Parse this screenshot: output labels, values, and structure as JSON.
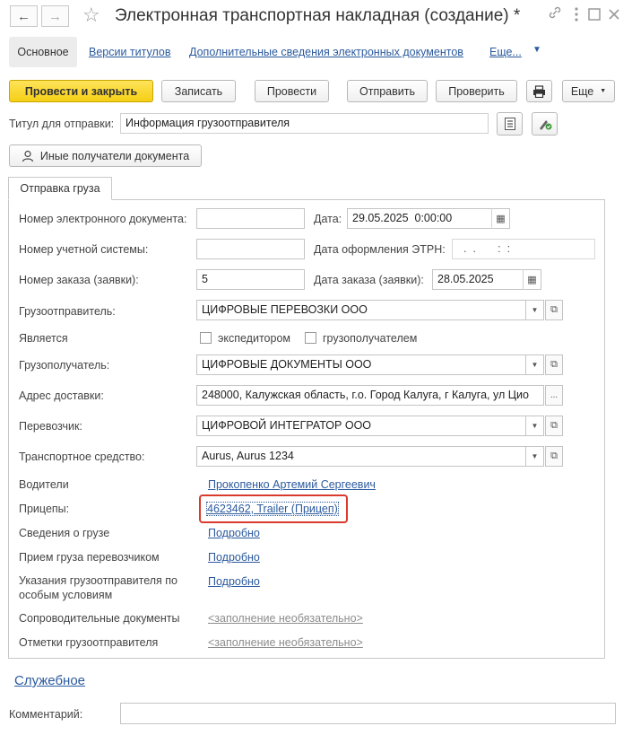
{
  "window": {
    "title": "Электронная транспортная накладная (создание) *",
    "nav": {
      "back_icon": "arrow-left-icon",
      "forward_icon": "arrow-right-icon"
    },
    "title_icons": [
      "star-icon",
      "link-icon",
      "more-vertical-icon",
      "maximize-icon",
      "close-icon"
    ]
  },
  "tabs": {
    "main": "Основное",
    "links": [
      "Версии титулов",
      "Дополнительные сведения электронных документов",
      "Еще..."
    ]
  },
  "toolbar": {
    "post_close": "Провести и закрыть",
    "save": "Записать",
    "post": "Провести",
    "send": "Отправить",
    "check": "Проверить",
    "more": "Еще"
  },
  "title_field": {
    "label": "Титул для отправки:",
    "value": "Информация грузоотправителя"
  },
  "other_recipients": "Иные получатели документа",
  "panel_tab": "Отправка груза",
  "form": {
    "doc_number": {
      "label": "Номер электронного документа:",
      "value": ""
    },
    "date": {
      "label": "Дата:",
      "value": "29.05.2025  0:00:00"
    },
    "account_number": {
      "label": "Номер учетной системы:",
      "value": ""
    },
    "etrn_date": {
      "label": "Дата оформления ЭТРН:",
      "value": "  .  .       :  :"
    },
    "order_number": {
      "label": "Номер заказа (заявки):",
      "value": "5"
    },
    "order_date": {
      "label": "Дата заказа (заявки):",
      "value": "28.05.2025"
    },
    "shipper": {
      "label": "Грузоотправитель:",
      "value": "ЦИФРОВЫЕ ПЕРЕВОЗКИ ООО"
    },
    "is": {
      "label": "Является",
      "forwarder": "экспедитором",
      "consignee": "грузополучателем"
    },
    "consignee": {
      "label": "Грузополучатель:",
      "value": "ЦИФРОВЫЕ ДОКУМЕНТЫ ООО"
    },
    "address": {
      "label": "Адрес доставки:",
      "value": "248000, Калужская область, г.о. Город Калуга, г Калуга, ул Цио"
    },
    "carrier": {
      "label": "Перевозчик:",
      "value": "ЦИФРОВОЙ ИНТЕГРАТОР ООО"
    },
    "vehicle": {
      "label": "Транспортное средство:",
      "value": "Aurus, Aurus 1234"
    },
    "drivers": {
      "label": "Водители",
      "value": "Прокопенко Артемий Сергеевич"
    },
    "trailers": {
      "label": "Прицепы:",
      "value": "4623462, Trailer (Прицеп)"
    },
    "cargo": {
      "label": "Сведения о грузе",
      "value": "Подробно"
    },
    "acceptance": {
      "label": "Прием груза перевозчиком",
      "value": "Подробно"
    },
    "instructions": {
      "label": "Указания грузоотправителя по",
      "label2": "особым условиям",
      "value": "Подробно"
    },
    "docs": {
      "label": "Сопроводительные документы",
      "value": "<заполнение необязательно>"
    },
    "marks": {
      "label": "Отметки грузоотправителя",
      "value": "<заполнение необязательно>"
    }
  },
  "service_link": "Служебное",
  "comment": {
    "label": "Комментарий:",
    "value": ""
  },
  "colors": {
    "accent": "#f5cf14",
    "link": "#2b5a9e",
    "highlight": "#d83b2e"
  }
}
